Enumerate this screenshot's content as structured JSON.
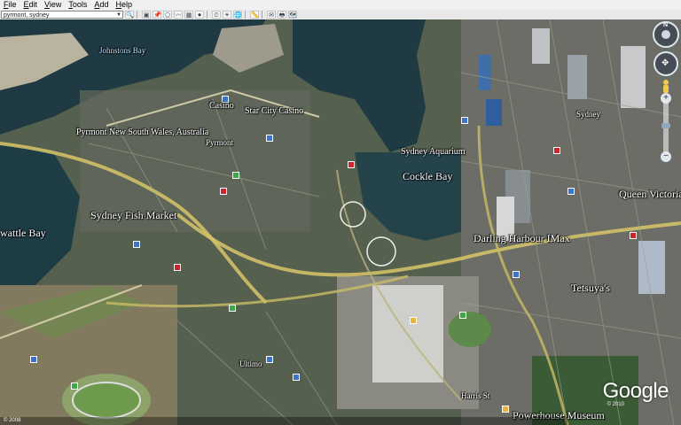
{
  "menu": [
    {
      "label": "File",
      "u": "F",
      "rest": "ile"
    },
    {
      "label": "Edit",
      "u": "E",
      "rest": "dit"
    },
    {
      "label": "View",
      "u": "V",
      "rest": "iew"
    },
    {
      "label": "Tools",
      "u": "T",
      "rest": "ools"
    },
    {
      "label": "Add",
      "u": "A",
      "rest": "dd"
    },
    {
      "label": "Help",
      "u": "H",
      "rest": "elp"
    }
  ],
  "search": {
    "value": "pyrmont, sydney"
  },
  "nav": {
    "north": "N"
  },
  "labels": {
    "johnstons_bay": "Johnstons Bay",
    "casino": "Casino",
    "star_city": "Star City Casino",
    "pyrmont": "Pyrmont New South Wales, Australia",
    "pyrmont_short": "Pyrmont",
    "sydney_aquarium": "Sydney Aquarium",
    "cockle_bay": "Cockle Bay",
    "sydney_fish_market": "Sydney Fish Market",
    "blackwattle_bay": "wattle Bay",
    "darling_harbour": "Darling Harbour IMax",
    "tetsuyas": "Tetsuya's",
    "queen_victoria": "Queen Victoria",
    "sydney": "Sydney",
    "powerhouse": "Powerhouse Museum",
    "ultimo": "Ultimo",
    "ultimo2": "Harris St"
  },
  "logo": "Google",
  "copyright": "© 2010",
  "status_text": "© 2008"
}
